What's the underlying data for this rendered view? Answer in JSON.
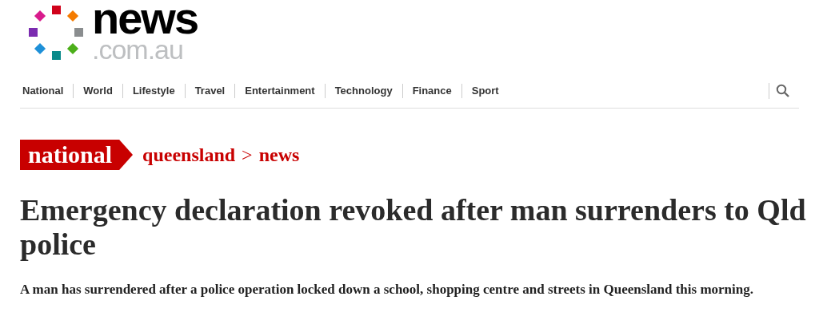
{
  "logo": {
    "name": "news",
    "domain": ".com.au"
  },
  "nav": {
    "items": [
      {
        "label": "National"
      },
      {
        "label": "World"
      },
      {
        "label": "Lifestyle"
      },
      {
        "label": "Travel"
      },
      {
        "label": "Entertainment"
      },
      {
        "label": "Technology"
      },
      {
        "label": "Finance"
      },
      {
        "label": "Sport"
      }
    ]
  },
  "breadcrumb": {
    "section": "national",
    "path": [
      "queensland",
      "news"
    ],
    "separator": ">"
  },
  "headline": "Emergency declaration revoked after man surrenders to Qld police",
  "summary": "A man has surrendered after a police operation locked down a school, shopping centre and streets in Queensland this morning."
}
